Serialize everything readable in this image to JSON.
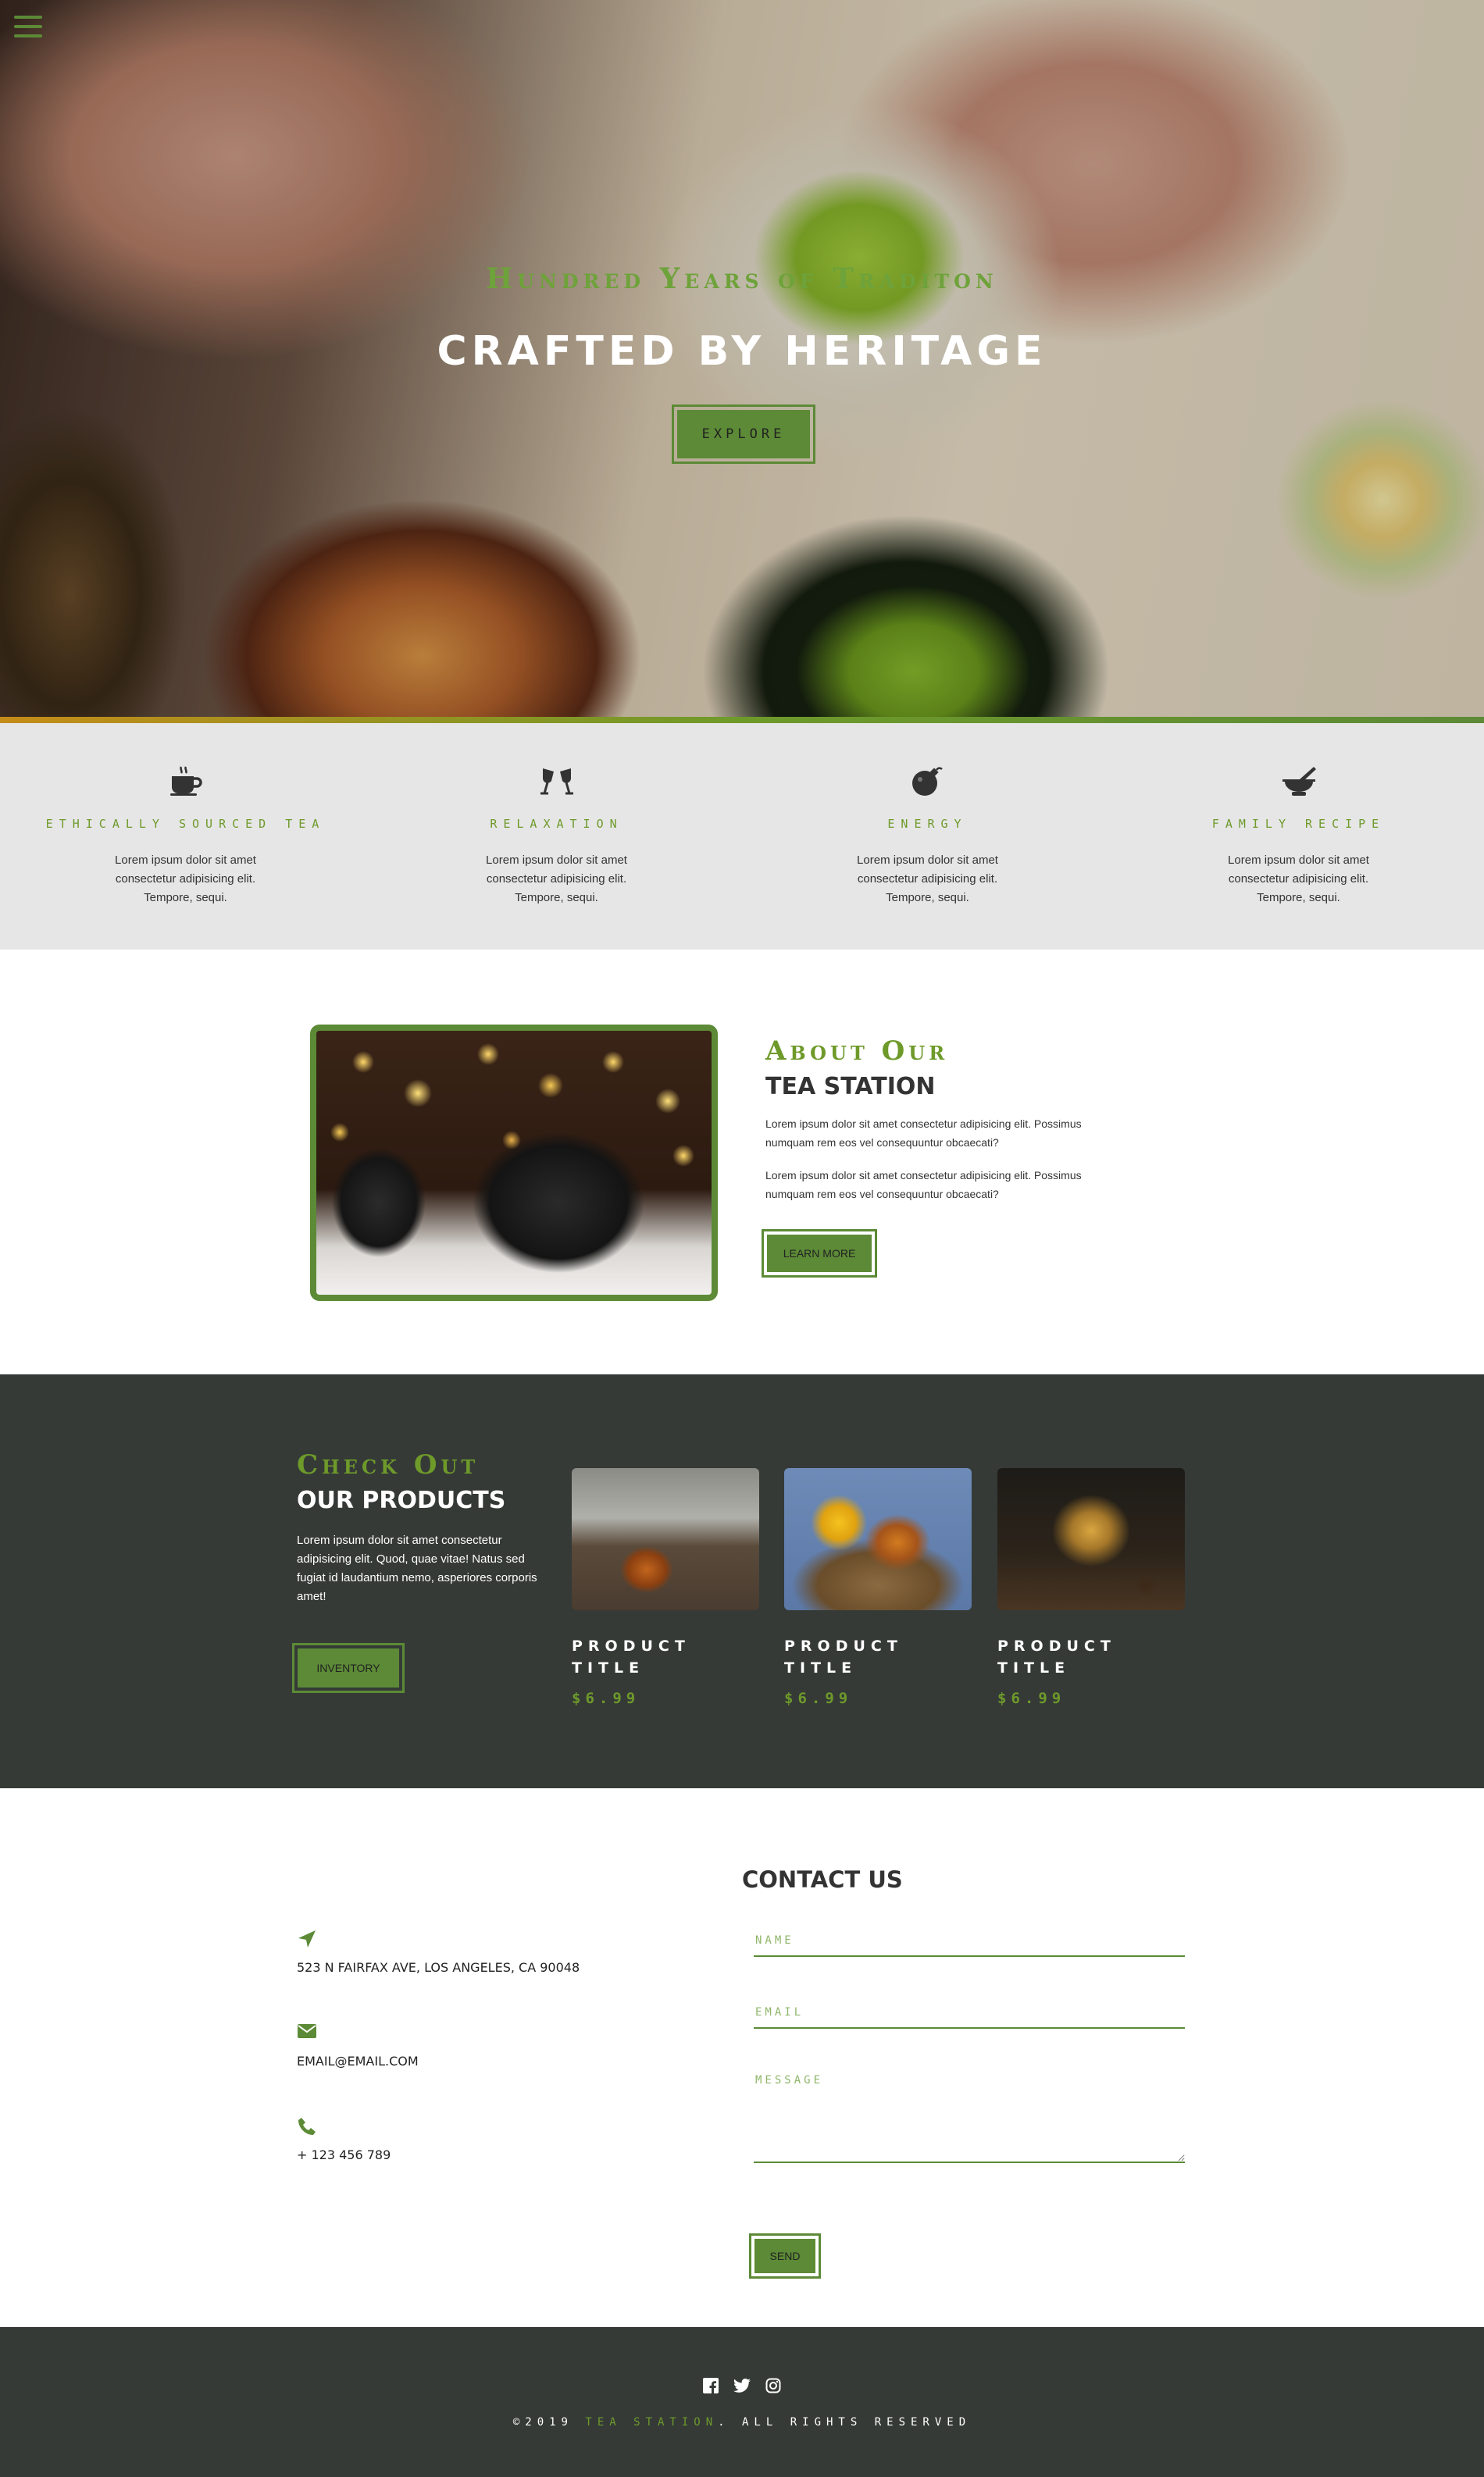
{
  "hero": {
    "kicker": "Hundred Years of Traditon",
    "title": "CRAFTED BY HERITAGE",
    "explore_label": "EXPLORE"
  },
  "features": [
    {
      "icon": "coffee-cup-icon",
      "title": "ETHICALLY SOURCED TEA",
      "text": "Lorem ipsum dolor sit amet consectetur adipisicing elit. Tempore, sequi."
    },
    {
      "icon": "wine-glasses-icon",
      "title": "RELAXATION",
      "text": "Lorem ipsum dolor sit amet consectetur adipisicing elit. Tempore, sequi."
    },
    {
      "icon": "bomb-icon",
      "title": "ENERGY",
      "text": "Lorem ipsum dolor sit amet consectetur adipisicing elit. Tempore, sequi."
    },
    {
      "icon": "mortar-pestle-icon",
      "title": "FAMILY RECIPE",
      "text": "Lorem ipsum dolor sit amet consectetur adipisicing elit. Tempore, sequi."
    }
  ],
  "about": {
    "kicker": "About Our",
    "title": "TEA STATION",
    "paragraphs": [
      "Lorem ipsum dolor sit amet consectetur adipisicing elit. Possimus numquam rem eos vel consequuntur obcaecati?",
      "Lorem ipsum dolor sit amet consectetur adipisicing elit. Possimus numquam rem eos vel consequuntur obcaecati?"
    ],
    "button_label": "LEARN MORE"
  },
  "products": {
    "kicker": "Check Out",
    "title": "OUR PRODUCTS",
    "text": "Lorem ipsum dolor sit amet consectetur adipisicing elit. Quod, quae vitae! Natus sed fugiat id laudantium nemo, asperiores corporis amet!",
    "button_label": "INVENTORY",
    "items": [
      {
        "name": "PRODUCT TITLE",
        "price": "$6.99"
      },
      {
        "name": "PRODUCT TITLE",
        "price": "$6.99"
      },
      {
        "name": "PRODUCT TITLE",
        "price": "$6.99"
      }
    ]
  },
  "contact": {
    "title": "CONTACT US",
    "address": "523 N FAIRFAX AVE, LOS ANGELES, CA 90048",
    "email": "EMAIL@EMAIL.COM",
    "phone": "+ 123 456 789",
    "name_placeholder": "NAME",
    "email_placeholder": "EMAIL",
    "message_placeholder": "MESSAGE",
    "send_label": "SEND"
  },
  "footer": {
    "copyright_prefix": "©2019 ",
    "brand": "TEA STATION",
    "copyright_suffix": ". ALL RIGHTS RESERVED"
  },
  "colors": {
    "accent": "#5c8a36",
    "dark": "#353a37",
    "light_gray": "#e6e6e6"
  }
}
